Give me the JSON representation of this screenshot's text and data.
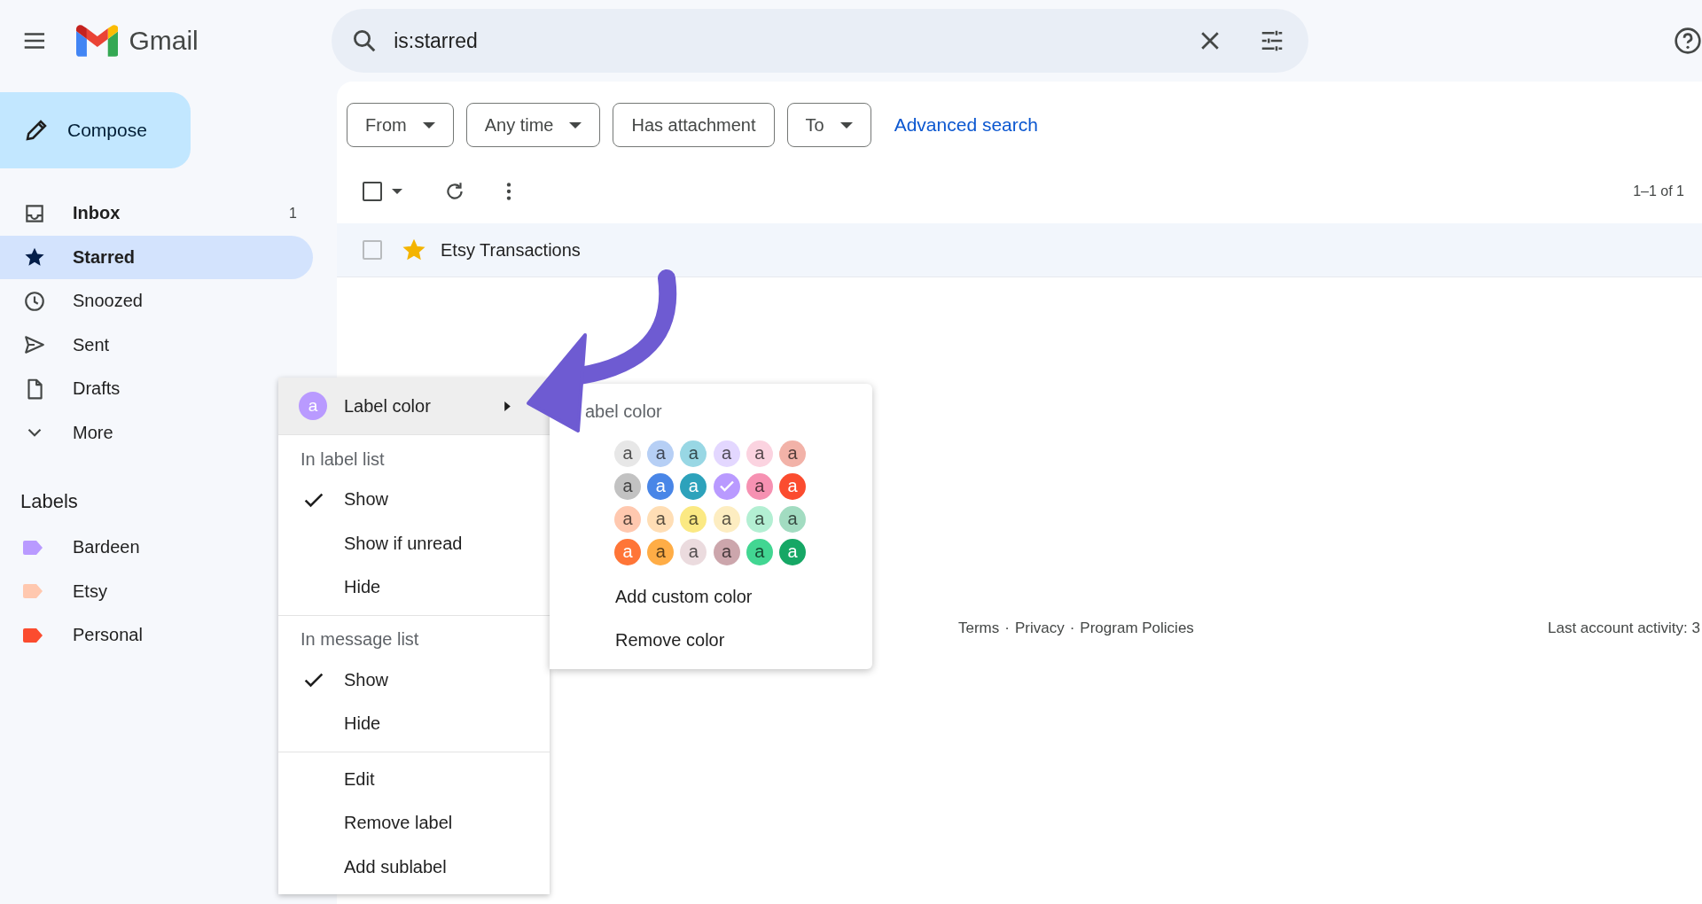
{
  "header": {
    "app_name": "Gmail",
    "search": {
      "value": "is:starred"
    }
  },
  "compose": {
    "label": "Compose"
  },
  "nav": [
    {
      "kind": "inbox",
      "label": "Inbox",
      "count": "1",
      "unread": true,
      "selected": false
    },
    {
      "kind": "star",
      "label": "Starred",
      "unread": false,
      "selected": true
    },
    {
      "kind": "clock",
      "label": "Snoozed",
      "unread": false,
      "selected": false
    },
    {
      "kind": "send",
      "label": "Sent",
      "unread": false,
      "selected": false
    },
    {
      "kind": "file",
      "label": "Drafts",
      "unread": false,
      "selected": false
    },
    {
      "kind": "more",
      "label": "More",
      "unread": false,
      "selected": false
    }
  ],
  "labels": {
    "title": "Labels",
    "items": [
      {
        "name": "Bardeen",
        "color": "#b99aff"
      },
      {
        "name": "Etsy",
        "color": "#ffc8af"
      },
      {
        "name": "Personal",
        "color": "#fb4c2f"
      }
    ]
  },
  "filters": [
    {
      "label": "From",
      "dropdown": true
    },
    {
      "label": "Any time",
      "dropdown": true
    },
    {
      "label": "Has attachment",
      "dropdown": false
    },
    {
      "label": "To",
      "dropdown": true
    }
  ],
  "advanced_search": "Advanced search",
  "select_all": {
    "checked": false
  },
  "pagination": "1–1 of 1",
  "emails": [
    {
      "sender": "Etsy Transactions",
      "starred": true,
      "checked": false
    }
  ],
  "footer": {
    "links": [
      "Terms",
      "Privacy",
      "Program Policies"
    ],
    "separator": "·",
    "activity": "Last account activity: 3"
  },
  "context_menu": {
    "label_color": {
      "label": "Label color",
      "avatar": "a",
      "color": "#b99aff",
      "highlighted": true
    },
    "sections": [
      {
        "heading": "In label list",
        "items": [
          {
            "label": "Show",
            "checked": true
          },
          {
            "label": "Show if unread",
            "checked": false
          },
          {
            "label": "Hide",
            "checked": false
          }
        ]
      },
      {
        "heading": "In message list",
        "items": [
          {
            "label": "Show",
            "checked": true
          },
          {
            "label": "Hide",
            "checked": false
          }
        ]
      },
      {
        "items": [
          {
            "label": "Edit"
          },
          {
            "label": "Remove label"
          },
          {
            "label": "Add sublabel"
          }
        ]
      }
    ]
  },
  "color_menu": {
    "title": "abel color",
    "swatches": [
      {
        "text": "a",
        "color": "#e7e7e7",
        "selected": false
      },
      {
        "text": "a",
        "color": "#b6cff5",
        "selected": false
      },
      {
        "text": "a",
        "color": "#98d7e4",
        "selected": false
      },
      {
        "text": "a",
        "color": "#e3d7ff",
        "selected": false
      },
      {
        "text": "a",
        "color": "#fbd3e0",
        "selected": false
      },
      {
        "text": "a",
        "color": "#f2b2a8",
        "selected": false
      },
      {
        "text": "a",
        "color": "#c2c2c2",
        "selected": false
      },
      {
        "text": "a",
        "color": "#4986e7",
        "selected": false
      },
      {
        "text": "a",
        "color": "#2da2bb",
        "selected": false
      },
      {
        "color": "#b99aff",
        "selected": true
      },
      {
        "text": "a",
        "color": "#f691b2",
        "selected": false
      },
      {
        "text": "a",
        "color": "#fb4c2f",
        "selected": false
      },
      {
        "text": "a",
        "color": "#ffc8af",
        "selected": false
      },
      {
        "text": "a",
        "color": "#ffdeb5",
        "selected": false
      },
      {
        "text": "a",
        "color": "#fbe983",
        "selected": false
      },
      {
        "text": "a",
        "color": "#fdedc1",
        "selected": false
      },
      {
        "text": "a",
        "color": "#b3efd3",
        "selected": false
      },
      {
        "text": "a",
        "color": "#a2dcc1",
        "selected": false
      },
      {
        "text": "a",
        "color": "#ff7537",
        "selected": false
      },
      {
        "text": "a",
        "color": "#ffad46",
        "selected": false
      },
      {
        "text": "a",
        "color": "#ebdbde",
        "selected": false
      },
      {
        "text": "a",
        "color": "#cca6ac",
        "selected": false
      },
      {
        "text": "a",
        "color": "#42d692",
        "selected": false
      },
      {
        "text": "a",
        "color": "#16a765",
        "selected": false
      }
    ],
    "actions": [
      "Add custom color",
      "Remove color"
    ]
  }
}
